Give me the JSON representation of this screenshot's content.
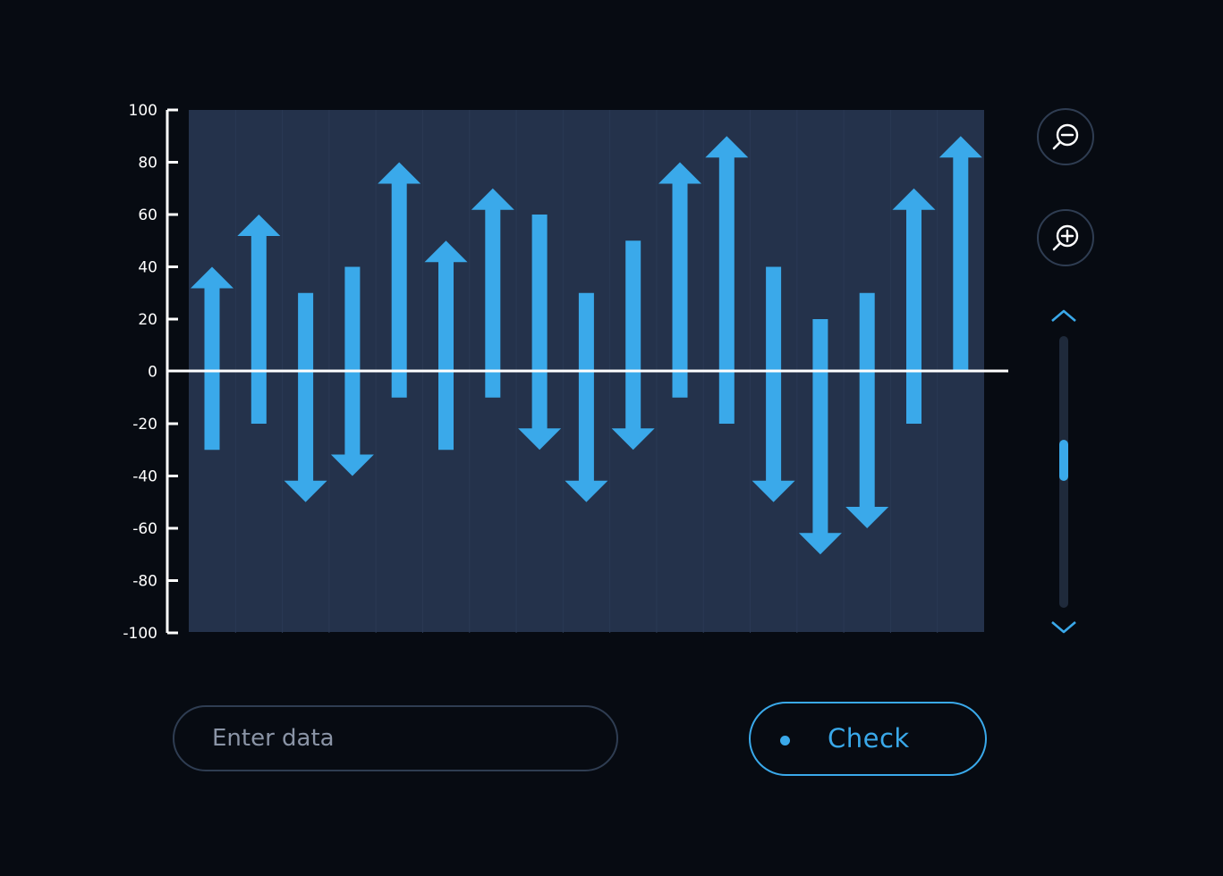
{
  "chart_data": {
    "type": "bar",
    "title": "",
    "xlabel": "",
    "ylabel": "",
    "ylim": [
      -100,
      100
    ],
    "yticks": [
      "100",
      "80",
      "60",
      "40",
      "20",
      "0",
      "-20",
      "-40",
      "-60",
      "-80",
      "-100"
    ],
    "series": [
      {
        "start": [
          -30,
          -20,
          30,
          40,
          -10,
          -30,
          -10,
          60,
          30,
          50,
          -10,
          -20,
          40,
          20,
          30,
          -20,
          0
        ],
        "end": [
          40,
          60,
          -50,
          -40,
          80,
          50,
          70,
          -30,
          -50,
          -30,
          80,
          90,
          -50,
          -70,
          -60,
          70,
          90
        ]
      }
    ],
    "grid": false,
    "colors": {
      "arrow": "#3aa9ea",
      "plot_bg": "#24324b",
      "axis": "#ffffff"
    }
  },
  "controls": {
    "zoom_out_icon": "zoom-out-icon",
    "zoom_in_icon": "zoom-in-icon",
    "scroll_up_icon": "chevron-up-icon",
    "scroll_down_icon": "chevron-down-icon",
    "scroll_position": 0.45
  },
  "input": {
    "placeholder": "Enter data",
    "value": ""
  },
  "check_button": {
    "label": "Check"
  },
  "colors": {
    "background": "#070b12",
    "accent": "#3aa9ea",
    "border": "#2f3d52"
  }
}
